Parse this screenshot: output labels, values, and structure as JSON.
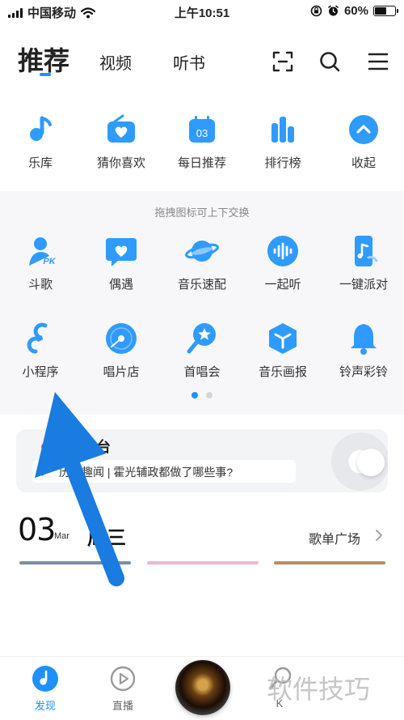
{
  "status_bar": {
    "carrier": "中国移动",
    "time": "上午10:51",
    "battery": "60%",
    "battery_level": 0.6
  },
  "header": {
    "tabs": [
      {
        "label": "推荐",
        "active": true
      },
      {
        "label": "视频"
      },
      {
        "label": "听书"
      }
    ],
    "icons": [
      "scan-icon",
      "search-icon",
      "menu-icon"
    ]
  },
  "quick_entries": [
    {
      "label": "乐库",
      "icon": "music-note-icon"
    },
    {
      "label": "猜你喜欢",
      "icon": "radio-heart-icon"
    },
    {
      "label": "每日推荐",
      "icon": "calendar-icon",
      "badge": "03"
    },
    {
      "label": "排行榜",
      "icon": "bar-chart-icon"
    },
    {
      "label": "收起",
      "icon": "chevron-up-icon"
    }
  ],
  "panel": {
    "hint": "拖拽图标可上下交换",
    "rows": [
      [
        {
          "label": "斗歌",
          "icon": "pk-person-icon",
          "mark": "PK"
        },
        {
          "label": "偶遇",
          "icon": "heart-chat-icon"
        },
        {
          "label": "音乐速配",
          "icon": "planet-icon"
        },
        {
          "label": "一起听",
          "icon": "soundwave-icon"
        },
        {
          "label": "一键派对",
          "icon": "phone-music-icon"
        }
      ],
      [
        {
          "label": "小程序",
          "icon": "mini-program-icon"
        },
        {
          "label": "唱片店",
          "icon": "vinyl-icon"
        },
        {
          "label": "首唱会",
          "icon": "mic-star-icon"
        },
        {
          "label": "音乐画报",
          "icon": "cube-icon"
        },
        {
          "label": "铃声彩铃",
          "icon": "bell-icon"
        }
      ]
    ],
    "page_count": 2,
    "active_page": 0
  },
  "radio_card": {
    "title": "电台",
    "news_text": "历史趣闻 | 霍光辅政都做了哪些事?"
  },
  "daily": {
    "day": "03",
    "month": "Mar",
    "weekday": "周三",
    "playlist_link": "歌单广场"
  },
  "bottom_nav": [
    {
      "label": "发现",
      "icon": "discover-icon",
      "active": true
    },
    {
      "label": "直播",
      "icon": "live-play-icon"
    },
    {
      "label": "",
      "icon": "now-playing-disc"
    },
    {
      "label": "K",
      "icon": "k-song-icon"
    }
  ],
  "watermark": "软件技巧",
  "colors": {
    "accent": "#1e90ff",
    "icon_blue": "#2f9bff",
    "arrow": "#1a7be0"
  }
}
